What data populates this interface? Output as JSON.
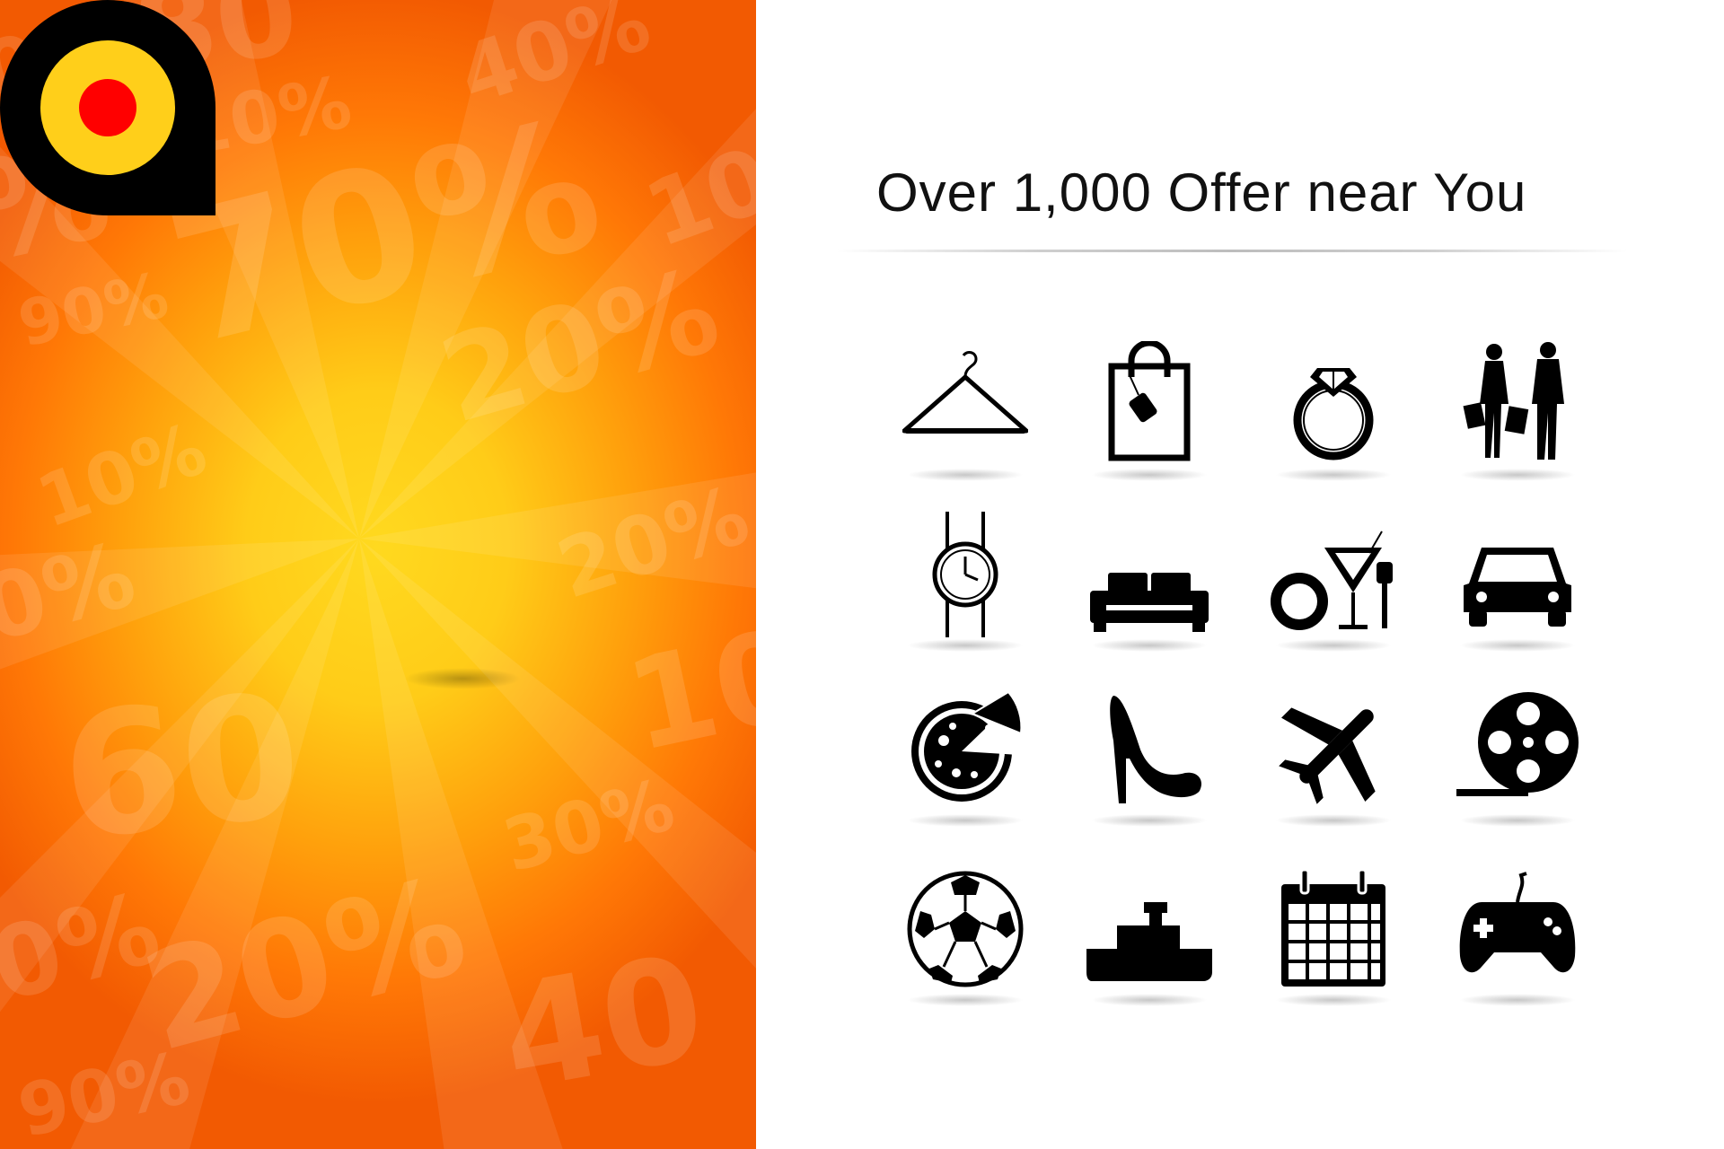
{
  "brand": {
    "logo_name": "location-pin-logo",
    "primary_color": "#000000",
    "accent_color": "#ff0000",
    "inner_color": "#ffcf1a"
  },
  "background_numbers": [
    "80",
    "0%",
    "10%",
    "40%",
    "%",
    "70%",
    "10",
    "90%",
    "20%",
    "10%",
    "0%",
    "20%",
    "60",
    "10",
    "30%",
    "20%",
    "40",
    "0%",
    "90%"
  ],
  "headline": {
    "text": "Over 1,000 Offer near You"
  },
  "categories": [
    {
      "icon": "hanger-icon"
    },
    {
      "icon": "shopping-bag-icon"
    },
    {
      "icon": "diamond-ring-icon"
    },
    {
      "icon": "shoppers-icon"
    },
    {
      "icon": "wristwatch-icon"
    },
    {
      "icon": "sofa-icon"
    },
    {
      "icon": "dining-icon"
    },
    {
      "icon": "car-icon"
    },
    {
      "icon": "pizza-icon"
    },
    {
      "icon": "high-heel-icon"
    },
    {
      "icon": "airplane-icon"
    },
    {
      "icon": "film-reel-icon"
    },
    {
      "icon": "soccer-ball-icon"
    },
    {
      "icon": "ship-icon"
    },
    {
      "icon": "calendar-icon"
    },
    {
      "icon": "gamepad-icon"
    }
  ]
}
